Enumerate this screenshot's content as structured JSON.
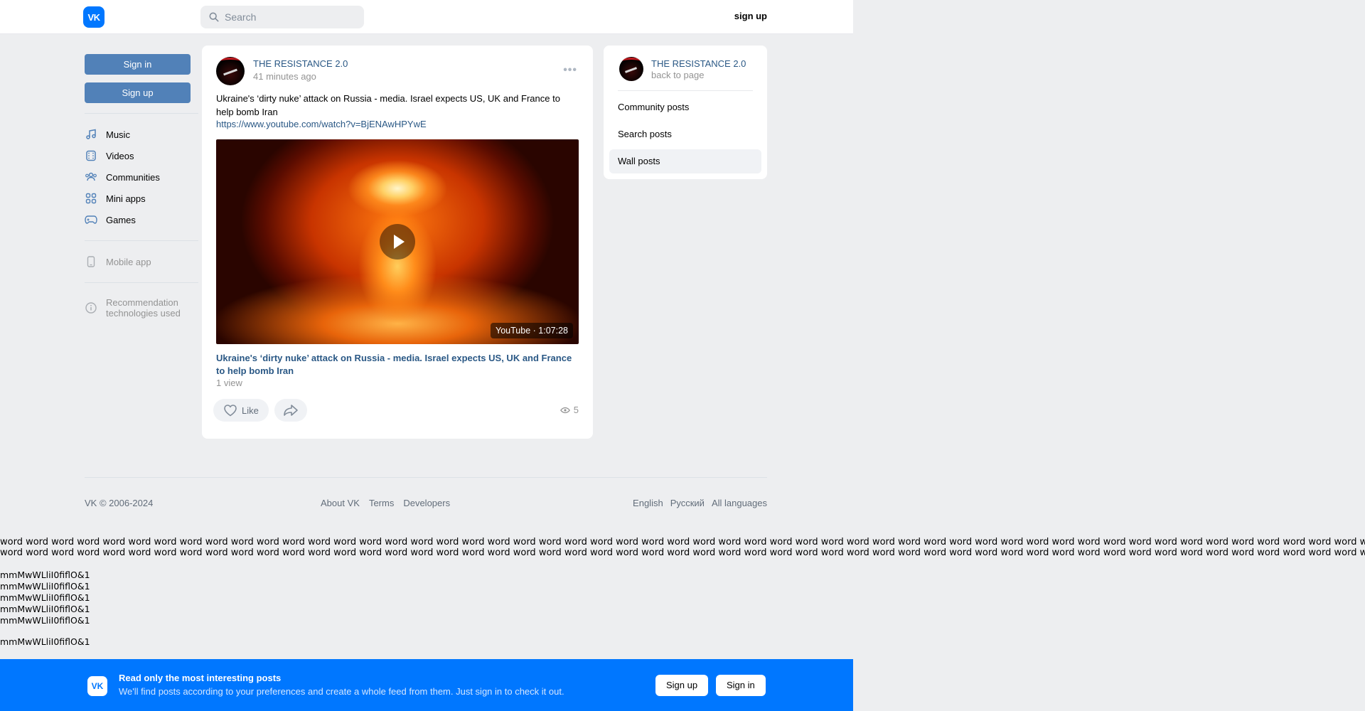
{
  "header": {
    "logo": "VK",
    "search_placeholder": "Search",
    "signup_label": "sign up"
  },
  "sidebar": {
    "signin_label": "Sign in",
    "signup_label": "Sign up",
    "items": [
      {
        "label": "Music",
        "icon": "music-icon"
      },
      {
        "label": "Videos",
        "icon": "video-icon"
      },
      {
        "label": "Communities",
        "icon": "communities-icon"
      },
      {
        "label": "Mini apps",
        "icon": "mini-apps-icon"
      },
      {
        "label": "Games",
        "icon": "games-icon"
      }
    ],
    "mobile_app": "Mobile app",
    "recommendation_line1": "Recommendation",
    "recommendation_line2": "technologies used"
  },
  "post": {
    "author": "THE RESISTANCE 2.0",
    "time": "41 minutes ago",
    "text": "Ukraine's ‘dirty nuke’ attack on Russia - media. Israel expects US, UK and France to help bomb Iran",
    "link": "https://www.youtube.com/watch?v=BjENAwHPYwE",
    "video_source": "YouTube",
    "video_duration": "1:07:28",
    "video_title": "Ukraine's ‘dirty nuke’ attack on Russia - media. Israel expects US, UK and France to help bomb Iran",
    "video_views": "1 view",
    "like_label": "Like",
    "views_count": "5"
  },
  "right_panel": {
    "name": "THE RESISTANCE 2.0",
    "back": "back to page",
    "items": [
      "Community posts",
      "Search posts",
      "Wall posts"
    ],
    "active_item": "Wall posts"
  },
  "footer": {
    "copyright": "VK © 2006-2024",
    "links": [
      "About VK",
      "Terms",
      "Developers"
    ],
    "languages": [
      "English",
      "Русский",
      "All languages"
    ]
  },
  "test_text": {
    "word_line": "word word word word word word word word word word word word word word word word word word word word word word word word word word word word word word word word word word word word word word word word word word word word word word word word word word word word word word word word word word",
    "sample": "mmMwWLliI0fiflO&1"
  },
  "banner": {
    "title": "Read only the most interesting posts",
    "subtitle": "We'll find posts according to your preferences and create a whole feed from them. Just sign in to check it out.",
    "signup_label": "Sign up",
    "signin_label": "Sign in"
  },
  "colors": {
    "brand": "#0077ff",
    "button": "#5181b8",
    "link": "#2a5885",
    "background": "#edeef0"
  }
}
